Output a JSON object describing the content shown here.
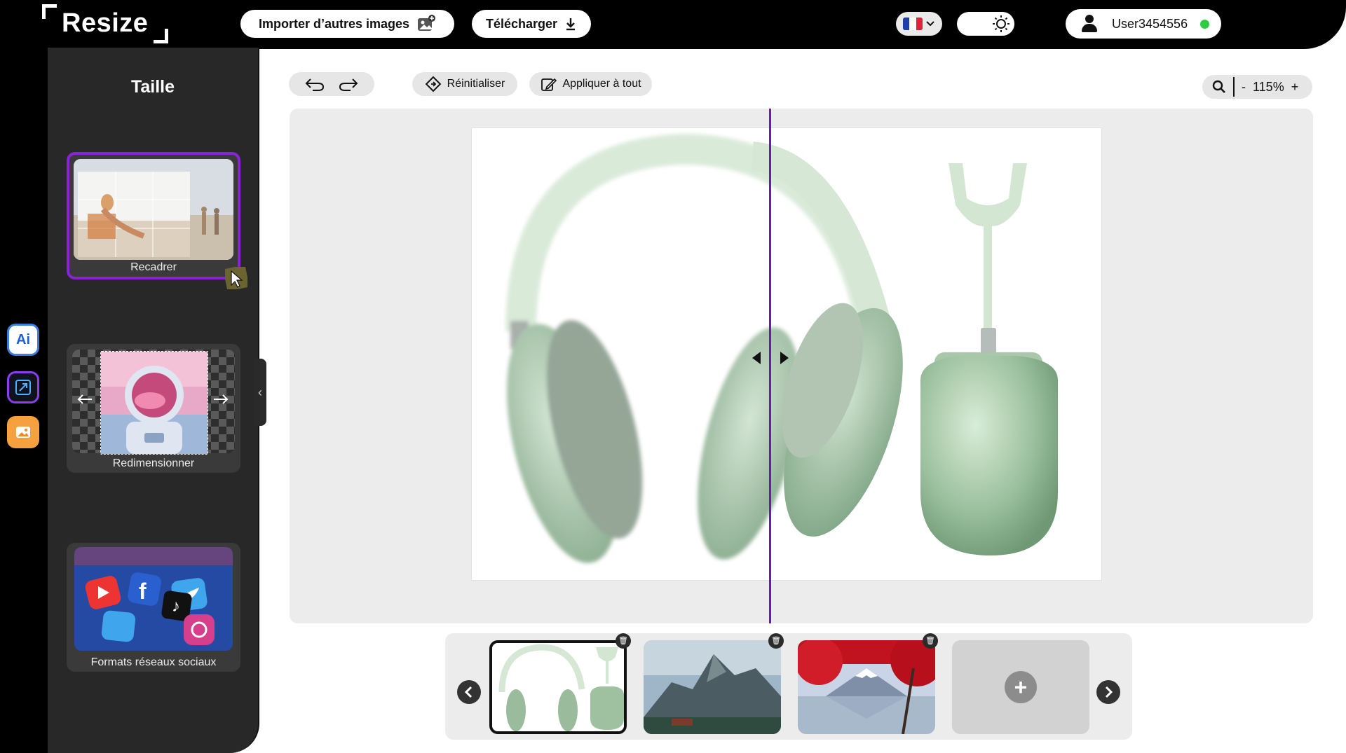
{
  "app": {
    "logo_text": "Resize"
  },
  "header": {
    "import_label": "Importer d’autres images",
    "download_label": "Télécharger",
    "language": "FR",
    "user_name": "User3454556"
  },
  "sidebar": {
    "title": "Taille",
    "tools": [
      {
        "label": "Recadrer",
        "active": true
      },
      {
        "label": "Redimensionner",
        "active": false
      },
      {
        "label": "Formats réseaux sociaux",
        "active": false
      }
    ]
  },
  "app_switcher": [
    {
      "name": "ai-tool",
      "label": "Ai"
    },
    {
      "name": "resize-tool"
    },
    {
      "name": "image-tool"
    }
  ],
  "toolbar": {
    "reset_label": "Réinitialiser",
    "apply_all_label": "Appliquer à tout",
    "zoom_minus": "-",
    "zoom_level": "115%",
    "zoom_plus": "+"
  },
  "filmstrip": {
    "images": [
      {
        "name": "headphones",
        "selected": true
      },
      {
        "name": "mountain-landscape",
        "selected": false
      },
      {
        "name": "mount-fuji-autumn",
        "selected": false
      }
    ],
    "add_label": "+"
  },
  "colors": {
    "accent_purple": "#8a22d6",
    "status_online": "#2ecc40",
    "panel_dark": "#282828"
  }
}
